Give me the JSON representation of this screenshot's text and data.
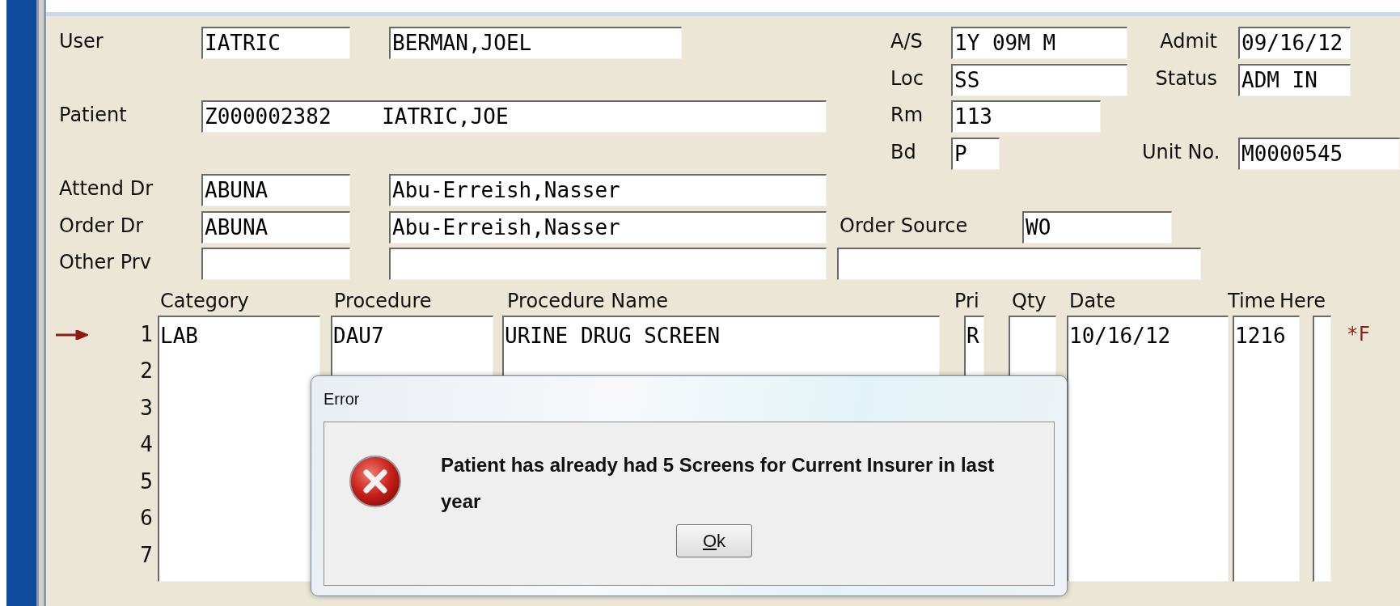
{
  "user": {
    "label": "User",
    "code": "IATRIC",
    "name": "BERMAN,JOEL"
  },
  "patient": {
    "label": "Patient",
    "value": "Z000002382    IATRIC,JOE"
  },
  "patient_info": [
    {
      "label": "A/S",
      "value": "1Y 09M M",
      "kind": "medium",
      "label_2": "Admit",
      "value_2": "09/16/12"
    },
    {
      "label": "Loc",
      "value": "SS",
      "kind": "medium",
      "label_2": "Status",
      "value_2": "ADM IN"
    },
    {
      "label": "Rm",
      "value": "113",
      "kind": "short"
    },
    {
      "label": "Bd",
      "value": "P",
      "kind": "tiny",
      "label_2": "Unit No.",
      "value_2": "M0000545"
    }
  ],
  "providers": [
    {
      "label": "Attend Dr",
      "code": "ABUNA",
      "name": "Abu-Erreish,Nasser"
    },
    {
      "label": "Order Dr",
      "code": "ABUNA",
      "name": "Abu-Erreish,Nasser",
      "extra": {
        "kind": "labeled",
        "label": "Order Source",
        "value": "WO"
      }
    },
    {
      "label": "Other Prv",
      "extra": {
        "kind": "blank"
      }
    }
  ],
  "columns": [
    "Category",
    "Procedure",
    "Procedure Name",
    "Pri",
    "Qty",
    "Date",
    "Time",
    "Here"
  ],
  "rows": [
    {
      "number": "1",
      "current": true,
      "category": "LAB",
      "procedure": "DAU7",
      "procedure_name": "URINE DRUG SCREEN",
      "pri": "R",
      "date": "10/16/12",
      "time": "1216",
      "flag": "*F"
    },
    {
      "number": "2",
      "current": false
    },
    {
      "number": "3",
      "current": false
    },
    {
      "number": "4",
      "current": false
    },
    {
      "number": "5",
      "current": false
    },
    {
      "number": "6",
      "current": false
    },
    {
      "number": "7",
      "current": false
    }
  ],
  "dialog": {
    "title": "Error",
    "message": "Patient has already had 5 Screens for Current Insurer in last year",
    "button": "Ok"
  }
}
